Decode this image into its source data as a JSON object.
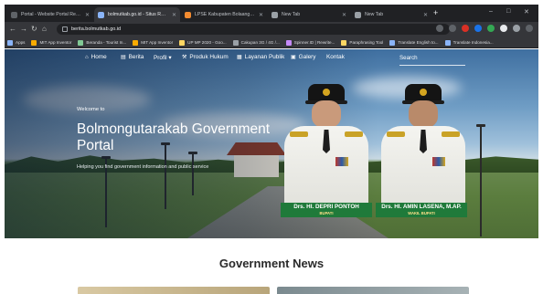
{
  "browser": {
    "tabs": [
      {
        "title": "Portal - Website Portal Resmi Pe",
        "favicon_color": "#5f6368",
        "active": false
      },
      {
        "title": "bolmutkab.go.id - Situs Resmi Pe",
        "favicon_color": "#8ab4f8",
        "active": true
      },
      {
        "title": "LPSE Kabupaten Bolaang Mongo",
        "favicon_color": "#f28b30",
        "active": false
      },
      {
        "title": "New Tab",
        "favicon_color": "#9aa0a6",
        "active": false
      },
      {
        "title": "New Tab",
        "favicon_color": "#9aa0a6",
        "active": false
      }
    ],
    "new_tab_symbol": "+",
    "window_controls": [
      "‒",
      "□",
      "✕"
    ],
    "url": "berita.bolmutkab.go.id",
    "bookmarks": [
      {
        "label": "Apps",
        "color": "#8ab4f8"
      },
      {
        "label": "MIT App Inventor",
        "color": "#f9ab00"
      },
      {
        "label": "Beranda - Tourist In...",
        "color": "#81c995"
      },
      {
        "label": "MIT App Inventor",
        "color": "#f9ab00"
      },
      {
        "label": "UP MP 2020 - Goo...",
        "color": "#fdd663"
      },
      {
        "label": "Cakupan 3G / 4G /...",
        "color": "#9aa0a6"
      },
      {
        "label": "Spinner.ID | Rewrite...",
        "color": "#c58af9"
      },
      {
        "label": "Paraphrasing Tool",
        "color": "#fdd663"
      },
      {
        "label": "Translate English to...",
        "color": "#8ab4f8"
      },
      {
        "label": "Translate Indonesia...",
        "color": "#8ab4f8"
      }
    ]
  },
  "site": {
    "nav": [
      {
        "label": "Home",
        "icon": "home-icon",
        "glyph": "⌂"
      },
      {
        "label": "Berita",
        "icon": "news-icon",
        "glyph": "▤"
      },
      {
        "label": "Profil ▾",
        "icon": "profile-icon",
        "glyph": ""
      },
      {
        "label": "Produk Hukum",
        "icon": "gavel-icon",
        "glyph": "⚒"
      },
      {
        "label": "Layanan Publik",
        "icon": "service-icon",
        "glyph": "▦"
      },
      {
        "label": "Galery",
        "icon": "gallery-icon",
        "glyph": "▣"
      },
      {
        "label": "Kontak",
        "icon": "contact-icon",
        "glyph": ""
      }
    ],
    "search_placeholder": "Search",
    "hero": {
      "welcome": "Welcome to",
      "title": "Bolmongutarakab Government Portal",
      "subtitle": "Helping you find government information and public service"
    },
    "officials": [
      {
        "name": "Drs. HI. DEPRI PONTOH",
        "role": "BUPATI"
      },
      {
        "name": "Drs. HI. AMIN LASENA, M.AP.",
        "role": "WAKIL BUPATI"
      }
    ],
    "section_title": "Government News",
    "colors": {
      "nav_text": "#ffffff",
      "name_bar": "#1f7a3a",
      "role_text": "#ffe08a",
      "section_title": "#2a2a2a"
    }
  }
}
